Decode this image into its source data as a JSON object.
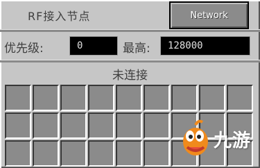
{
  "window": {
    "title": "RF接入节点"
  },
  "toolbar": {
    "network_button_label": "Network"
  },
  "priority": {
    "label": "优先级:",
    "value": "0"
  },
  "max": {
    "label": "最高:",
    "value": "128000"
  },
  "status": {
    "text": "未连接"
  },
  "inventory": {
    "slot_count": 27
  },
  "watermark": {
    "text": "九游"
  },
  "colors": {
    "panel": "#c6c6c6",
    "slot": "#8b8b8b",
    "field_bg": "#000000",
    "watermark_orange": "#f08a1c"
  }
}
